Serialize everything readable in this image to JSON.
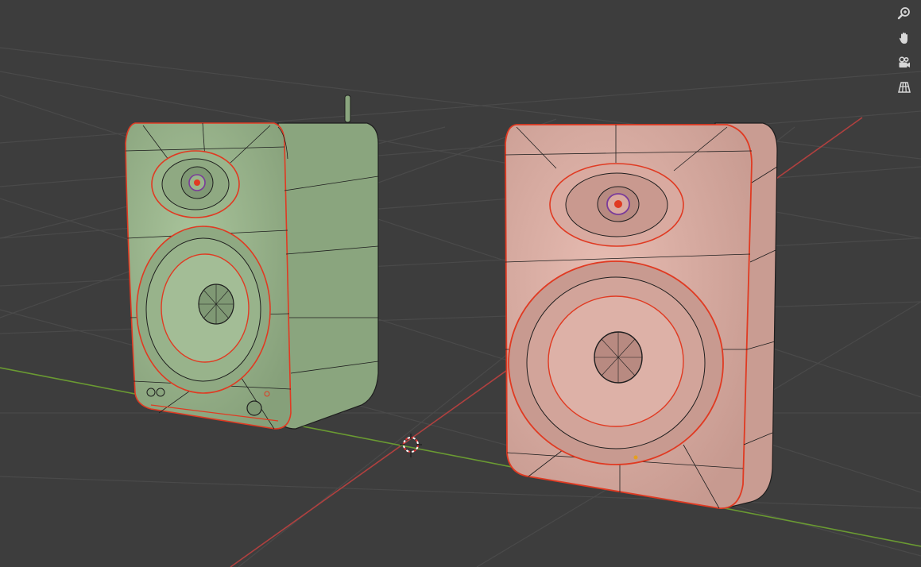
{
  "viewport": {
    "background": "#3d3d3d",
    "grid_color": "#4a4a4a",
    "x_axis_color": "#b0403f",
    "y_axis_color": "#6a9a32"
  },
  "navigation_gizmo": {
    "buttons": [
      {
        "name": "zoom-button",
        "icon": "zoom-icon"
      },
      {
        "name": "pan-button",
        "icon": "hand-icon"
      },
      {
        "name": "camera-view-button",
        "icon": "camera-icon"
      },
      {
        "name": "perspective-toggle-button",
        "icon": "grid-icon"
      }
    ],
    "icon_color": "#d8d8d8"
  },
  "objects": {
    "left_speaker": {
      "name": "green-speaker",
      "color": "#9ab58c",
      "side_color": "#8aa57e",
      "wire_color": "#1e1e1e",
      "seam_color": "#e03a22"
    },
    "right_speaker": {
      "name": "pink-speaker",
      "color": "#d9aaa0",
      "side_color": "#c99c92",
      "wire_color": "#1e1e1e",
      "seam_color": "#e03a22"
    },
    "cursor_3d": {
      "name": "3d-cursor",
      "colors": [
        "#d33",
        "#ffffff"
      ]
    }
  }
}
